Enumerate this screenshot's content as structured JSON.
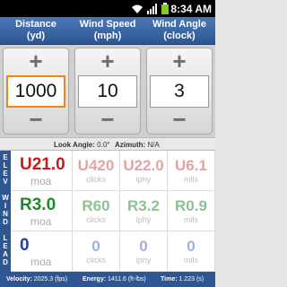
{
  "status": {
    "time": "8:34 AM",
    "icons": [
      "wifi-icon",
      "signal-icon",
      "battery-icon"
    ]
  },
  "header": [
    {
      "line1": "Distance",
      "line2": "(yd)"
    },
    {
      "line1": "Wind Speed",
      "line2": "(mph)"
    },
    {
      "line1": "Wind Angle",
      "line2": "(clock)"
    }
  ],
  "inputs": {
    "plus": "+",
    "minus": "−",
    "distance": "1000",
    "wind_speed": "10",
    "wind_angle": "3"
  },
  "look": {
    "look_label": "Look Angle:",
    "look_value": "0.0°",
    "az_label": "Azimuth:",
    "az_value": "N/A"
  },
  "side": {
    "elev": [
      "E",
      "L",
      "E",
      "V"
    ],
    "wind": [
      "W",
      "I",
      "N",
      "D"
    ],
    "lead": [
      "L",
      "E",
      "A",
      "D"
    ]
  },
  "rows": {
    "elev": {
      "main": "U21.0",
      "main_unit": "moa",
      "cells": [
        {
          "v": "U420",
          "u": "clicks"
        },
        {
          "v": "U22.0",
          "u": "iphy"
        },
        {
          "v": "U6.1",
          "u": "mils"
        }
      ]
    },
    "wind": {
      "main": "R3.0",
      "main_unit": "moa",
      "cells": [
        {
          "v": "R60",
          "u": "clicks"
        },
        {
          "v": "R3.2",
          "u": "iphy"
        },
        {
          "v": "R0.9",
          "u": "mils"
        }
      ]
    },
    "lead": {
      "main": "0",
      "main_unit": "moa",
      "cells": [
        {
          "v": "0",
          "u": "clicks"
        },
        {
          "v": "0",
          "u": "iphy"
        },
        {
          "v": "0",
          "u": "mils"
        }
      ]
    }
  },
  "bottom": {
    "velocity_label": "Velocity:",
    "velocity_value": "2025.3 (fps)",
    "energy_label": "Energy:",
    "energy_value": "1411.6 (ft-lbs)",
    "time_label": "Time:",
    "time_value": "1.223 (s)"
  }
}
